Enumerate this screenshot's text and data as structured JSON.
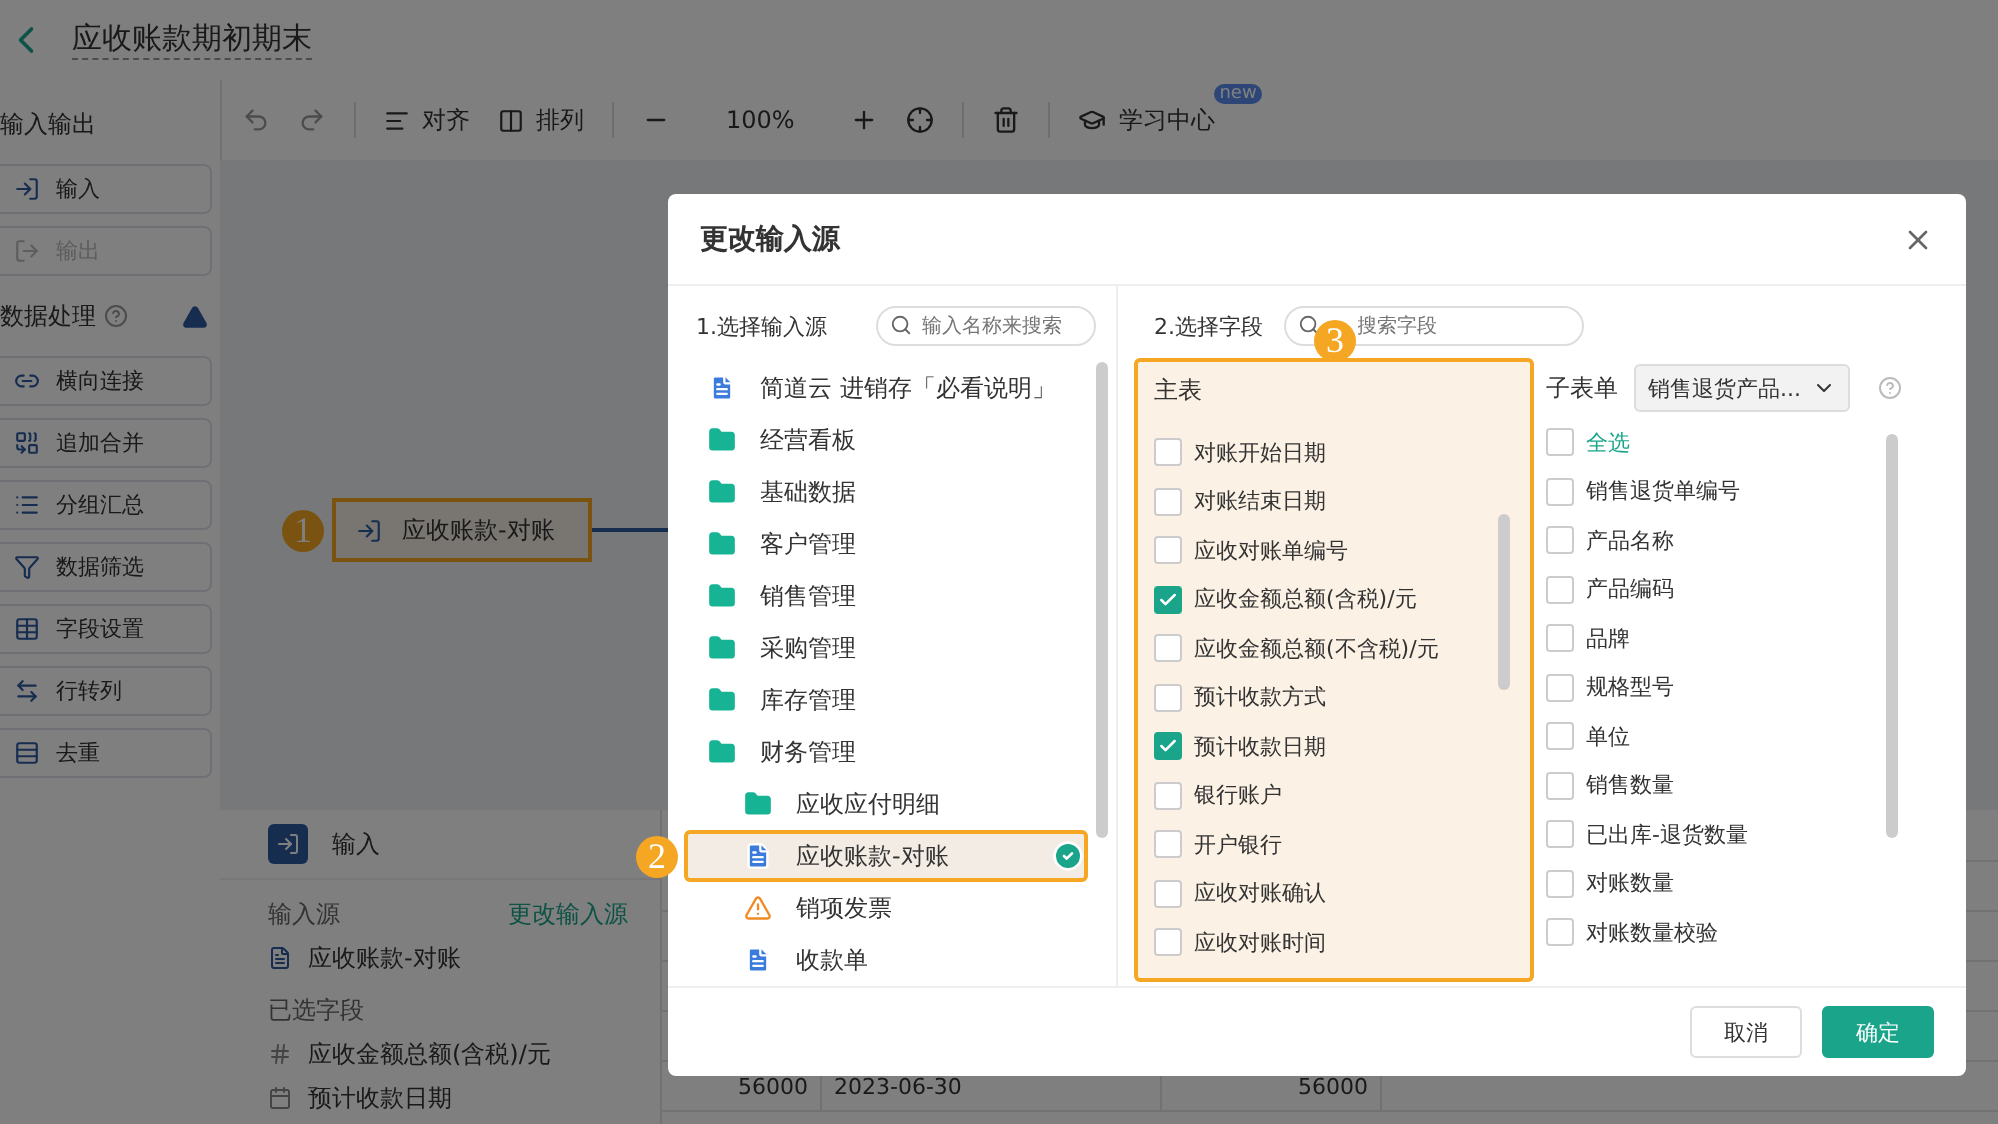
{
  "page": {
    "title": "应收账款期初期末"
  },
  "sidebar": {
    "sections": [
      {
        "title": "输入输出",
        "items": [
          {
            "kind": "input",
            "label": "输入",
            "disabled": false
          },
          {
            "kind": "output",
            "label": "输出",
            "disabled": true
          }
        ]
      },
      {
        "title": "数据处理",
        "items": [
          {
            "kind": "join",
            "label": "横向连接",
            "disabled": false
          },
          {
            "kind": "append",
            "label": "追加合并",
            "disabled": false
          },
          {
            "kind": "group",
            "label": "分组汇总",
            "disabled": false
          },
          {
            "kind": "filter",
            "label": "数据筛选",
            "disabled": false
          },
          {
            "kind": "fields",
            "label": "字段设置",
            "disabled": false
          },
          {
            "kind": "pivot",
            "label": "行转列",
            "disabled": false
          },
          {
            "kind": "dedupe",
            "label": "去重",
            "disabled": false
          }
        ]
      }
    ]
  },
  "toolbar": {
    "align": "对齐",
    "arrange": "排列",
    "zoom": "100%",
    "learn": "学习中心",
    "learn_badge": "new"
  },
  "canvas": {
    "node": {
      "label": "应收账款-对账",
      "marker": "1"
    }
  },
  "input_panel": {
    "title": "输入",
    "source_label": "输入源",
    "change_link": "更改输入源",
    "source": "应收账款-对账",
    "fields_label": "已选字段",
    "fields": [
      {
        "kind": "number",
        "label": "应收金额总额(含税)/元"
      },
      {
        "kind": "date",
        "label": "预计收款日期"
      }
    ]
  },
  "table": {
    "rows": [
      [
        "56000",
        "2023-06-30",
        "56000"
      ]
    ]
  },
  "dialog": {
    "title": "更改输入源",
    "source_step": "1.选择输入源",
    "source_search": {
      "placeholder": "输入名称来搜索"
    },
    "sources": [
      {
        "kind": "doc",
        "label": "简道云 进销存「必看说明」",
        "selected": false
      },
      {
        "kind": "folder",
        "label": "经营看板",
        "selected": false
      },
      {
        "kind": "folder",
        "label": "基础数据",
        "selected": false
      },
      {
        "kind": "folder",
        "label": "客户管理",
        "selected": false
      },
      {
        "kind": "folder",
        "label": "销售管理",
        "selected": false
      },
      {
        "kind": "folder",
        "label": "采购管理",
        "selected": false
      },
      {
        "kind": "folder",
        "label": "库存管理",
        "selected": false
      },
      {
        "kind": "folder",
        "label": "财务管理",
        "selected": false,
        "children": [
          {
            "kind": "folder",
            "label": "应收应付明细",
            "selected": false
          },
          {
            "kind": "doc",
            "label": "应收账款-对账",
            "selected": true,
            "marker": "2"
          },
          {
            "kind": "alert",
            "label": "销项发票",
            "selected": false
          },
          {
            "kind": "doc",
            "label": "收款单",
            "selected": false
          }
        ]
      }
    ],
    "field_step": "2.选择字段",
    "field_search": {
      "placeholder": "搜索字段"
    },
    "field_marker": "3",
    "main_table": {
      "title": "主表",
      "fields": [
        {
          "label": "对账开始日期",
          "checked": false
        },
        {
          "label": "对账结束日期",
          "checked": false
        },
        {
          "label": "应收对账单编号",
          "checked": false
        },
        {
          "label": "应收金额总额(含税)/元",
          "checked": true
        },
        {
          "label": "应收金额总额(不含税)/元",
          "checked": false
        },
        {
          "label": "预计收款方式",
          "checked": false
        },
        {
          "label": "预计收款日期",
          "checked": true
        },
        {
          "label": "银行账户",
          "checked": false
        },
        {
          "label": "开户银行",
          "checked": false
        },
        {
          "label": "应收对账确认",
          "checked": false
        },
        {
          "label": "应收对账时间",
          "checked": false
        }
      ]
    },
    "sub_table": {
      "label": "子表单",
      "value": "销售退货产品...",
      "fields": [
        {
          "kind": "all",
          "label": "全选",
          "checked": false
        },
        {
          "kind": "field",
          "label": "销售退货单编号",
          "checked": false
        },
        {
          "kind": "field",
          "label": "产品名称",
          "checked": false
        },
        {
          "kind": "field",
          "label": "产品编码",
          "checked": false
        },
        {
          "kind": "field",
          "label": "品牌",
          "checked": false
        },
        {
          "kind": "field",
          "label": "规格型号",
          "checked": false
        },
        {
          "kind": "field",
          "label": "单位",
          "checked": false
        },
        {
          "kind": "field",
          "label": "销售数量",
          "checked": false
        },
        {
          "kind": "field",
          "label": "已出库-退货数量",
          "checked": false
        },
        {
          "kind": "field",
          "label": "对账数量",
          "checked": false
        },
        {
          "kind": "field",
          "label": "对账数量校验",
          "checked": false
        }
      ]
    },
    "buttons": [
      {
        "kind": "secondary",
        "label": "取消"
      },
      {
        "kind": "primary",
        "label": "确定"
      }
    ]
  }
}
